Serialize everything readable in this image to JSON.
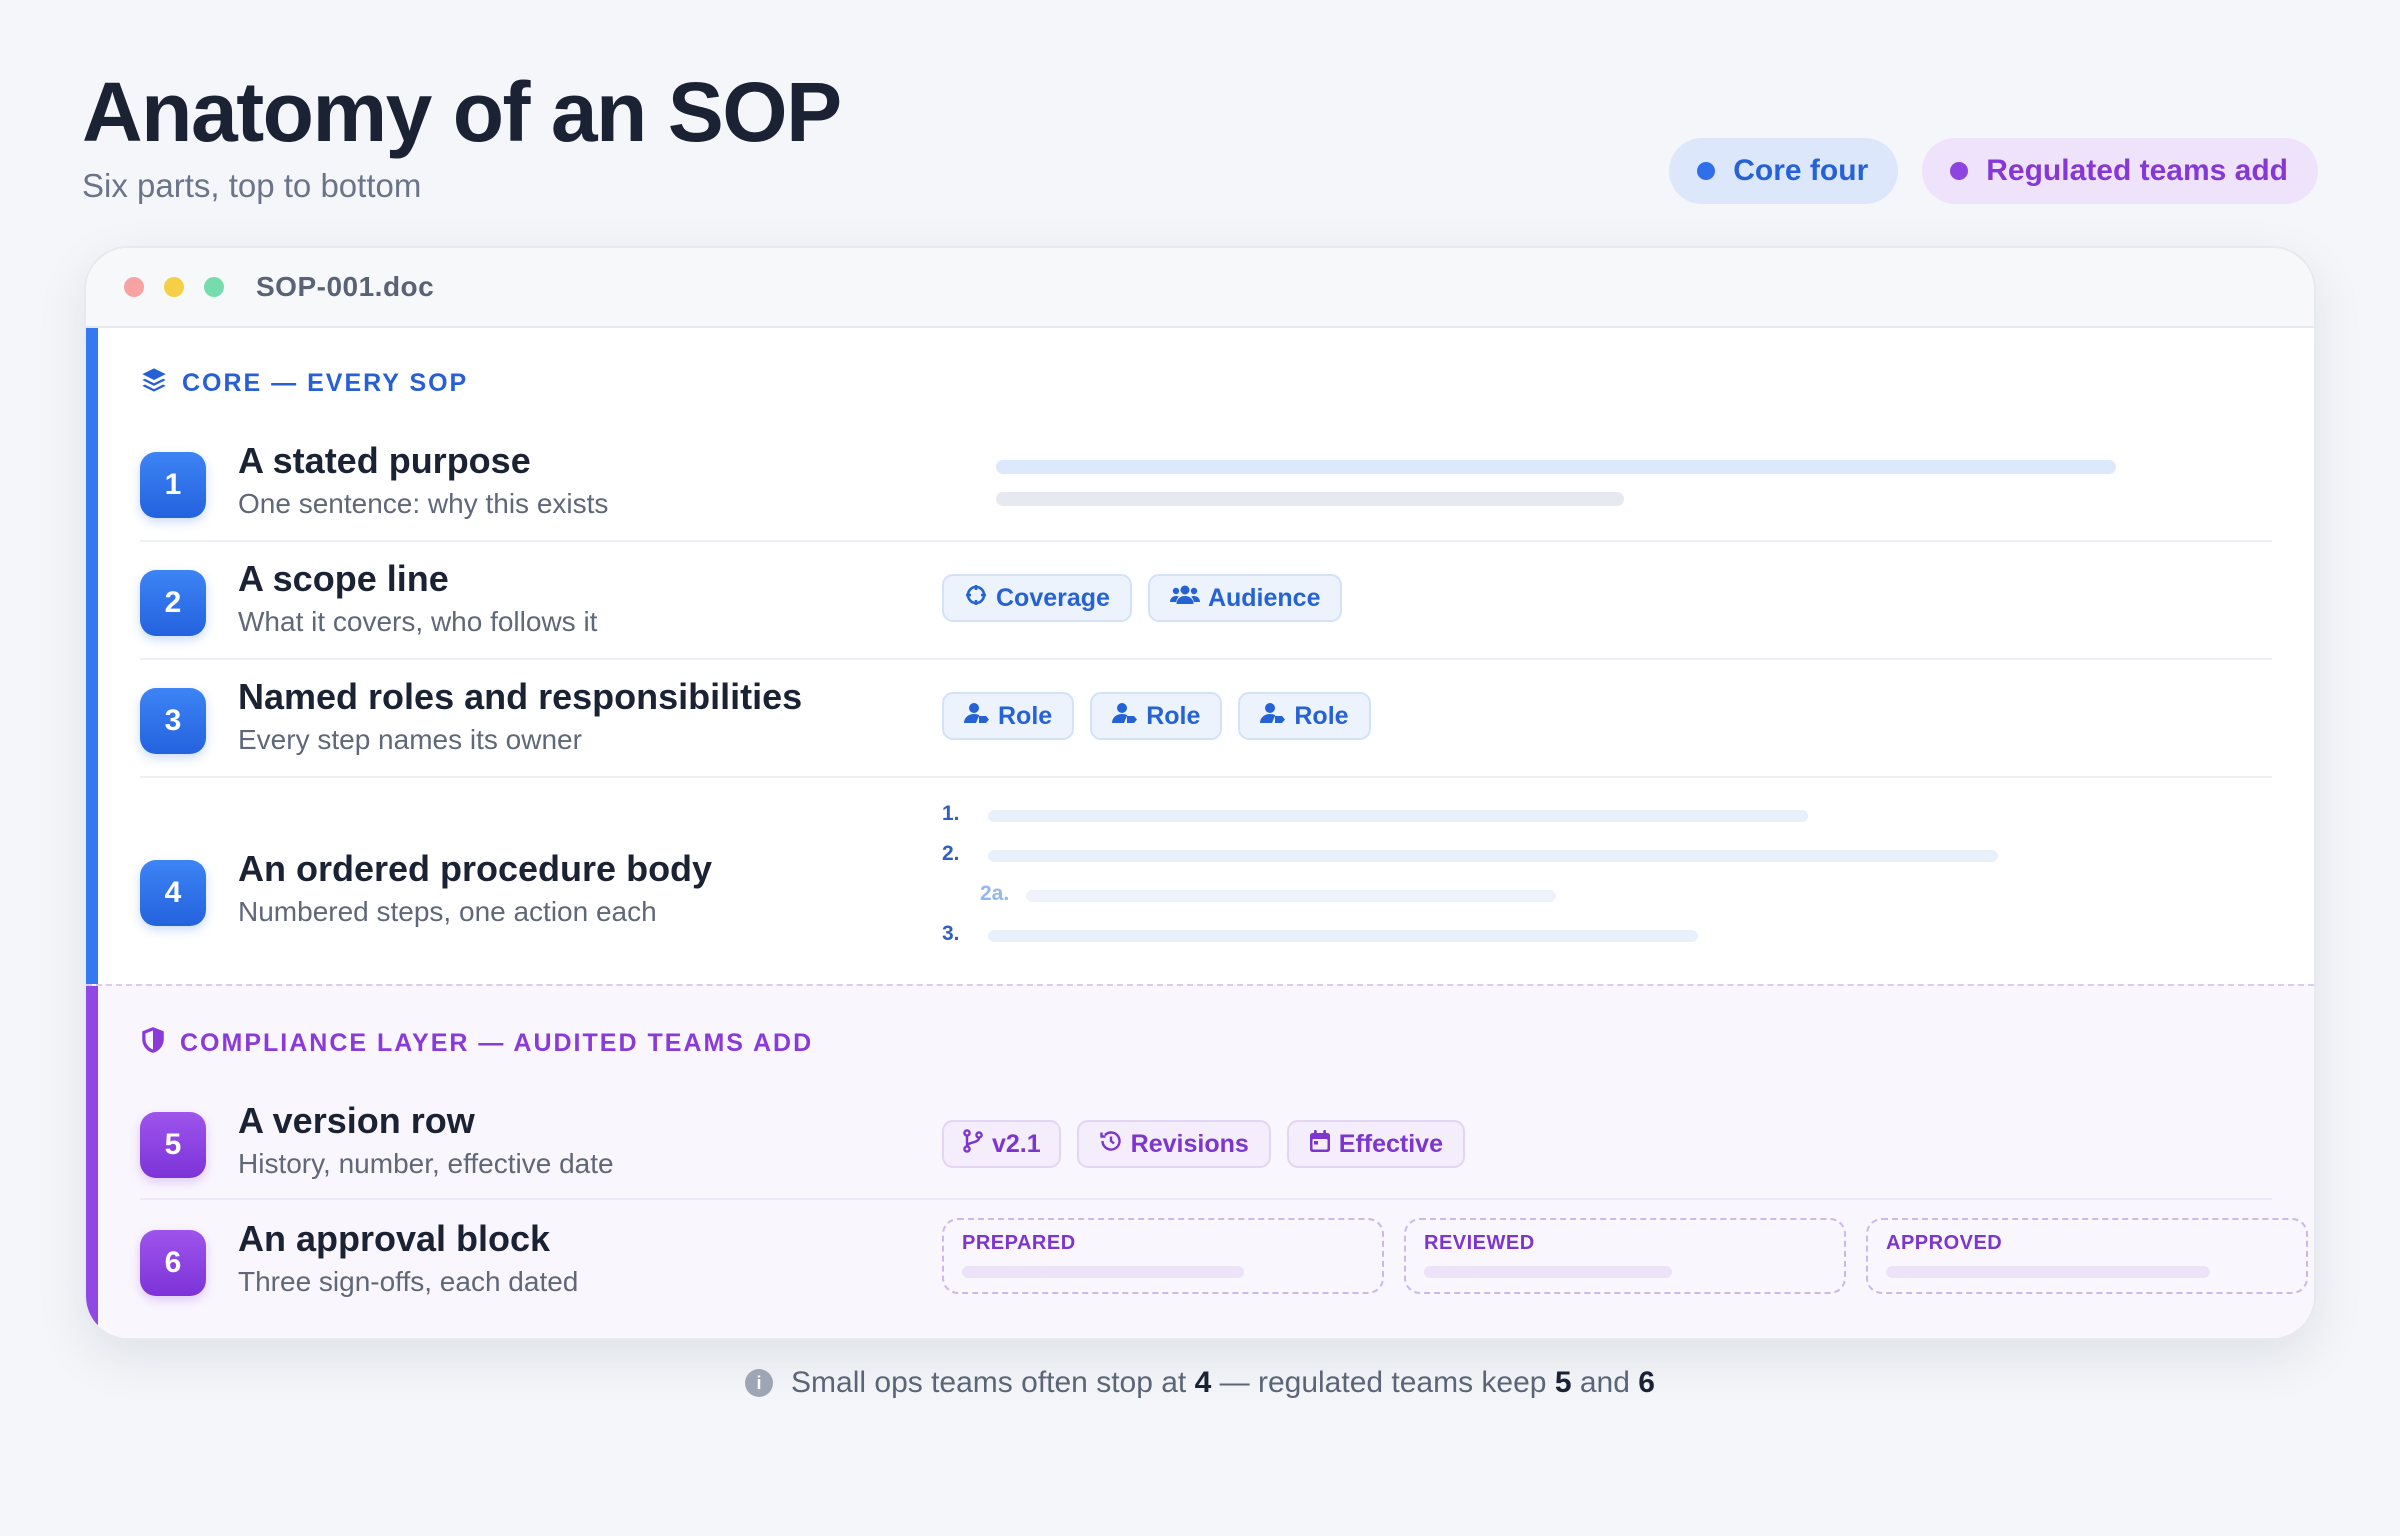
{
  "header": {
    "title": "Anatomy of an SOP",
    "subtitle": "Six parts, top to bottom"
  },
  "legend": {
    "core": {
      "label": "Core four",
      "color": "#2f6fea"
    },
    "regulated": {
      "label": "Regulated teams add",
      "color": "#8e44e0"
    }
  },
  "window": {
    "doc_name": "SOP-001.doc"
  },
  "core": {
    "header": "CORE — EVERY SOP",
    "header_icon": "layers-icon",
    "rows": [
      {
        "number": "1",
        "title": "A stated purpose",
        "desc": "One sentence: why this exists"
      },
      {
        "number": "2",
        "title": "A scope line",
        "desc": "What it covers, who follows it",
        "chips": [
          {
            "icon": "crosshair-icon",
            "label": "Coverage"
          },
          {
            "icon": "users-icon",
            "label": "Audience"
          }
        ]
      },
      {
        "number": "3",
        "title": "Named roles and responsibilities",
        "desc": "Every step names its owner",
        "chips": [
          {
            "icon": "user-tag-icon",
            "label": "Role"
          },
          {
            "icon": "user-tag-icon",
            "label": "Role"
          },
          {
            "icon": "user-tag-icon",
            "label": "Role"
          }
        ]
      },
      {
        "number": "4",
        "title": "An ordered procedure body",
        "desc": "Numbered steps, one action each",
        "steps": [
          "1.",
          "2.",
          "2a.",
          "3."
        ]
      }
    ]
  },
  "compliance": {
    "header": "COMPLIANCE LAYER — AUDITED TEAMS ADD",
    "header_icon": "shield-icon",
    "rows": [
      {
        "number": "5",
        "title": "A version row",
        "desc": "History, number, effective date",
        "chips": [
          {
            "icon": "branch-icon",
            "label": "v2.1"
          },
          {
            "icon": "history-icon",
            "label": "Revisions"
          },
          {
            "icon": "calendar-icon",
            "label": "Effective"
          }
        ]
      },
      {
        "number": "6",
        "title": "An approval block",
        "desc": "Three sign-offs, each dated",
        "signoffs": [
          "PREPARED",
          "REVIEWED",
          "APPROVED"
        ]
      }
    ]
  },
  "footnote": {
    "text_a": "Small ops teams often stop at",
    "num_a": "4",
    "text_b": "— regulated teams keep",
    "num_b": "5",
    "text_c": "and",
    "num_c": "6"
  }
}
